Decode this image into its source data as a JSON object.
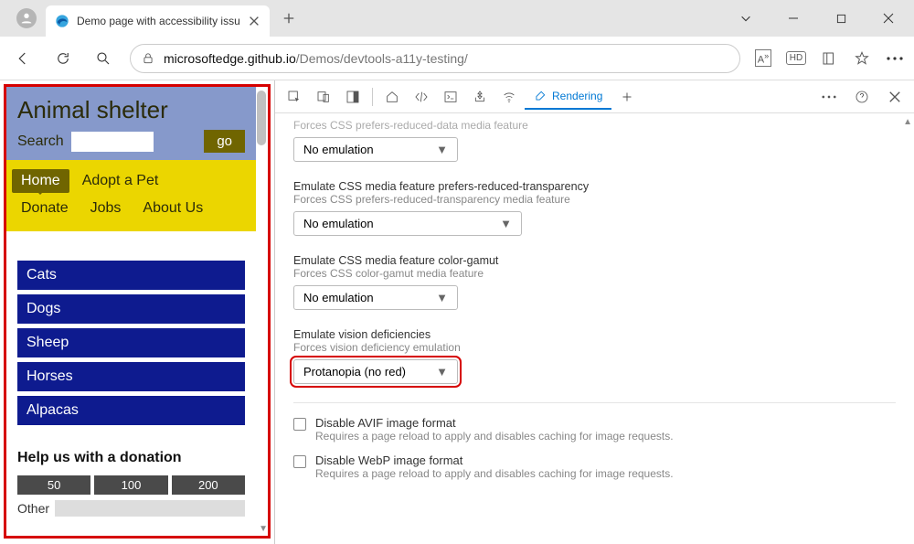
{
  "browser": {
    "tab_title": "Demo page with accessibility issu",
    "url_prefix": "microsoftedge.github.io",
    "url_path": "/Demos/devtools-a11y-testing/"
  },
  "page": {
    "title": "Animal shelter",
    "search_label": "Search",
    "go_label": "go",
    "nav": [
      "Home",
      "Adopt a Pet",
      "Donate",
      "Jobs",
      "About Us"
    ],
    "animals": [
      "Cats",
      "Dogs",
      "Sheep",
      "Horses",
      "Alpacas"
    ],
    "donation_title": "Help us with a donation",
    "donation_amounts": [
      "50",
      "100",
      "200"
    ],
    "donation_other": "Other"
  },
  "devtools": {
    "active_tab": "Rendering",
    "sections": {
      "reduced_data": {
        "sub": "Forces CSS prefers-reduced-data media feature",
        "value": "No emulation"
      },
      "transparency": {
        "title": "Emulate CSS media feature prefers-reduced-transparency",
        "sub": "Forces CSS prefers-reduced-transparency media feature",
        "value": "No emulation"
      },
      "gamut": {
        "title": "Emulate CSS media feature color-gamut",
        "sub": "Forces CSS color-gamut media feature",
        "value": "No emulation"
      },
      "vision": {
        "title": "Emulate vision deficiencies",
        "sub": "Forces vision deficiency emulation",
        "value": "Protanopia (no red)"
      },
      "avif": {
        "label": "Disable AVIF image format",
        "sub": "Requires a page reload to apply and disables caching for image requests."
      },
      "webp": {
        "label": "Disable WebP image format",
        "sub": "Requires a page reload to apply and disables caching for image requests."
      }
    }
  }
}
